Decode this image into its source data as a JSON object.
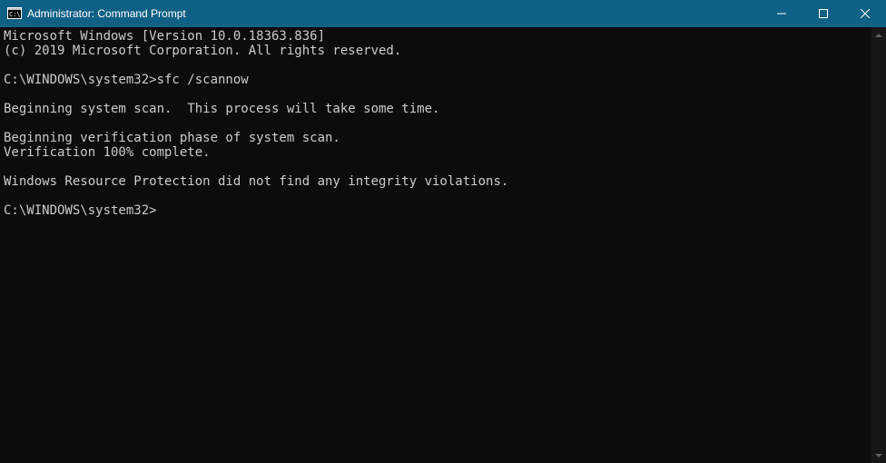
{
  "window": {
    "title": "Administrator: Command Prompt",
    "icon": "cmd-icon"
  },
  "terminal": {
    "header_line1": "Microsoft Windows [Version 10.0.18363.836]",
    "header_line2": "(c) 2019 Microsoft Corporation. All rights reserved.",
    "prompt1_path": "C:\\WINDOWS\\system32>",
    "prompt1_cmd": "sfc /scannow",
    "out_line1": "Beginning system scan.  This process will take some time.",
    "out_line2": "Beginning verification phase of system scan.",
    "out_line3": "Verification 100% complete.",
    "out_line4": "Windows Resource Protection did not find any integrity violations.",
    "prompt2_path": "C:\\WINDOWS\\system32>"
  }
}
